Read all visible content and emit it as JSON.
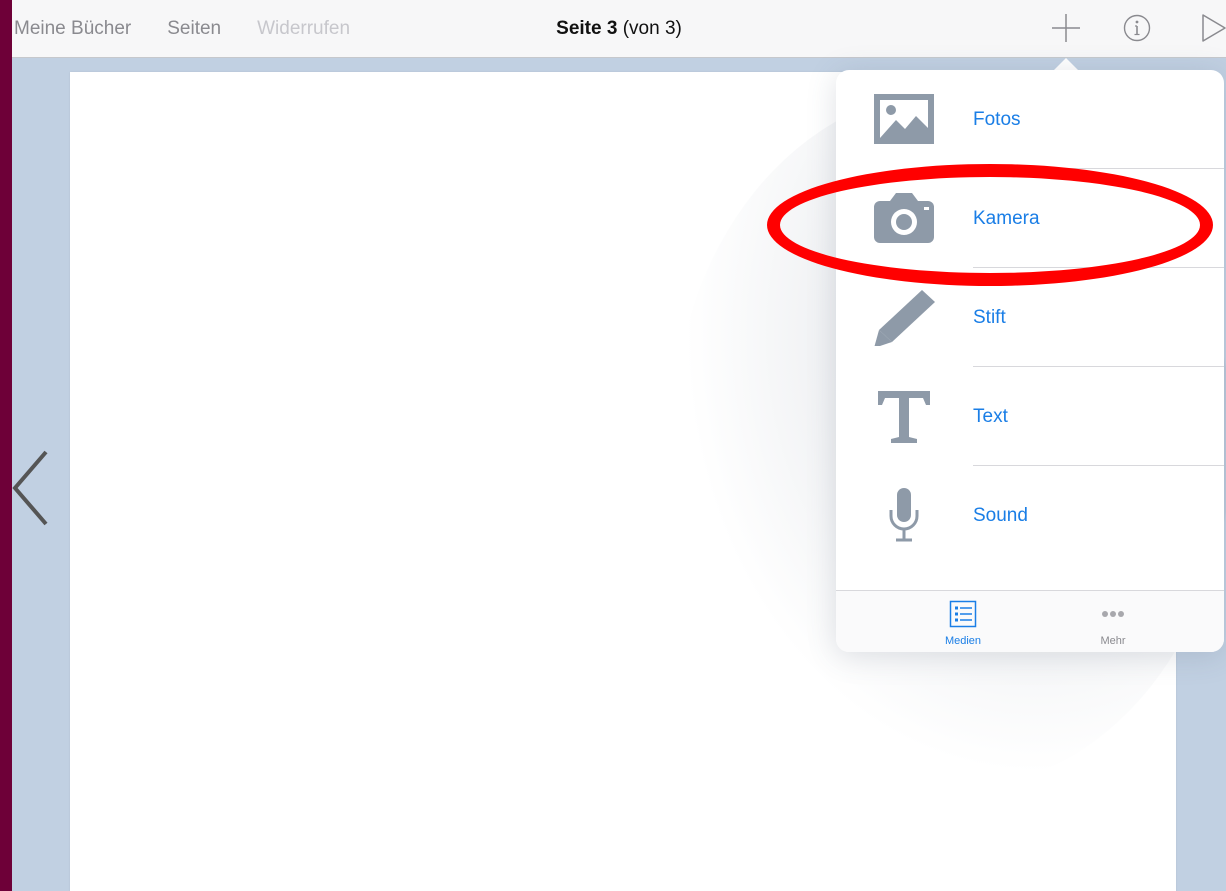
{
  "navbar": {
    "left_items": [
      "Meine Bücher",
      "Seiten",
      "Widerrufen"
    ],
    "title_bold": "Seite 3",
    "title_rest": " (von 3)",
    "icons": [
      "plus-icon",
      "info-icon",
      "play-icon"
    ]
  },
  "popover": {
    "items": [
      {
        "label": "Fotos",
        "icon": "photo-icon"
      },
      {
        "label": "Kamera",
        "icon": "camera-icon"
      },
      {
        "label": "Stift",
        "icon": "pencil-icon"
      },
      {
        "label": "Text",
        "icon": "text-icon"
      },
      {
        "label": "Sound",
        "icon": "microphone-icon"
      }
    ],
    "tabs": [
      {
        "label": "Medien",
        "icon": "list-icon",
        "active": true
      },
      {
        "label": "Mehr",
        "icon": "ellipsis-icon",
        "active": false
      }
    ]
  },
  "colors": {
    "accent": "#1a7ee6",
    "icon_gray": "#8e9aa8",
    "annotation": "#ff0000",
    "frame": "#6e0038",
    "canvas_bg": "#c1d0e2"
  },
  "annotation": {
    "highlighted_item": "Kamera"
  }
}
